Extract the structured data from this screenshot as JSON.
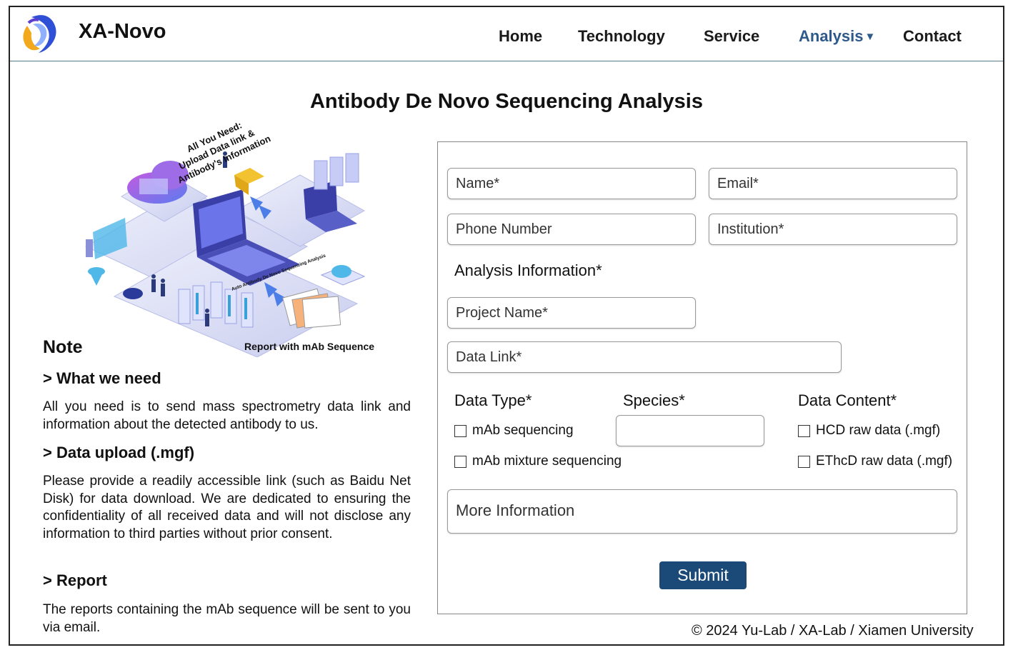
{
  "brand": {
    "name": "XA-Novo"
  },
  "nav": {
    "items": [
      {
        "label": "Home"
      },
      {
        "label": "Technology"
      },
      {
        "label": "Service"
      },
      {
        "label": "Analysis"
      },
      {
        "label": "Contact"
      }
    ],
    "active_color": "#2d5a8a"
  },
  "page": {
    "title": "Antibody De Novo Sequencing Analysis"
  },
  "illustration": {
    "caption_top": [
      "All You Need:",
      "Upload Data link &",
      "Antibody's Information"
    ],
    "caption_mid": "Auto Antibody De Novo Sequencing Analysis",
    "caption_bottom": "Report with mAb Sequence"
  },
  "note": {
    "heading": "Note",
    "sections": [
      {
        "title": "> What we need",
        "text": "All you need is to send mass spectrometry data link and information about the detected antibody to us."
      },
      {
        "title": "> Data upload (.mgf)",
        "text": "Please provide a readily accessible link (such as Baidu Net Disk) for data download. We are dedicated to ensuring the confidentiality of all received data and will not disclose any information to third parties without prior consent."
      },
      {
        "title": "> Report",
        "text": "The reports containing the mAb sequence will be sent to you via email."
      }
    ]
  },
  "form": {
    "name_placeholder": "Name*",
    "email_placeholder": "Email*",
    "phone_placeholder": "Phone Number",
    "institution_placeholder": "Institution*",
    "analysis_heading": "Analysis Information*",
    "project_placeholder": "Project Name*",
    "datalink_placeholder": "Data Link*",
    "data_type_label": "Data Type*",
    "species_label": "Species*",
    "species_value": "",
    "data_content_label": "Data Content*",
    "data_type_options": [
      "mAb sequencing",
      "mAb mixture sequencing"
    ],
    "data_content_options": [
      "HCD raw data (.mgf)",
      "EThcD raw data (.mgf)"
    ],
    "more_info_placeholder": "More Information",
    "submit_label": "Submit",
    "submit_color": "#1c4a78"
  },
  "footer": {
    "text": "© 2024 Yu-Lab / XA-Lab / Xiamen University"
  }
}
